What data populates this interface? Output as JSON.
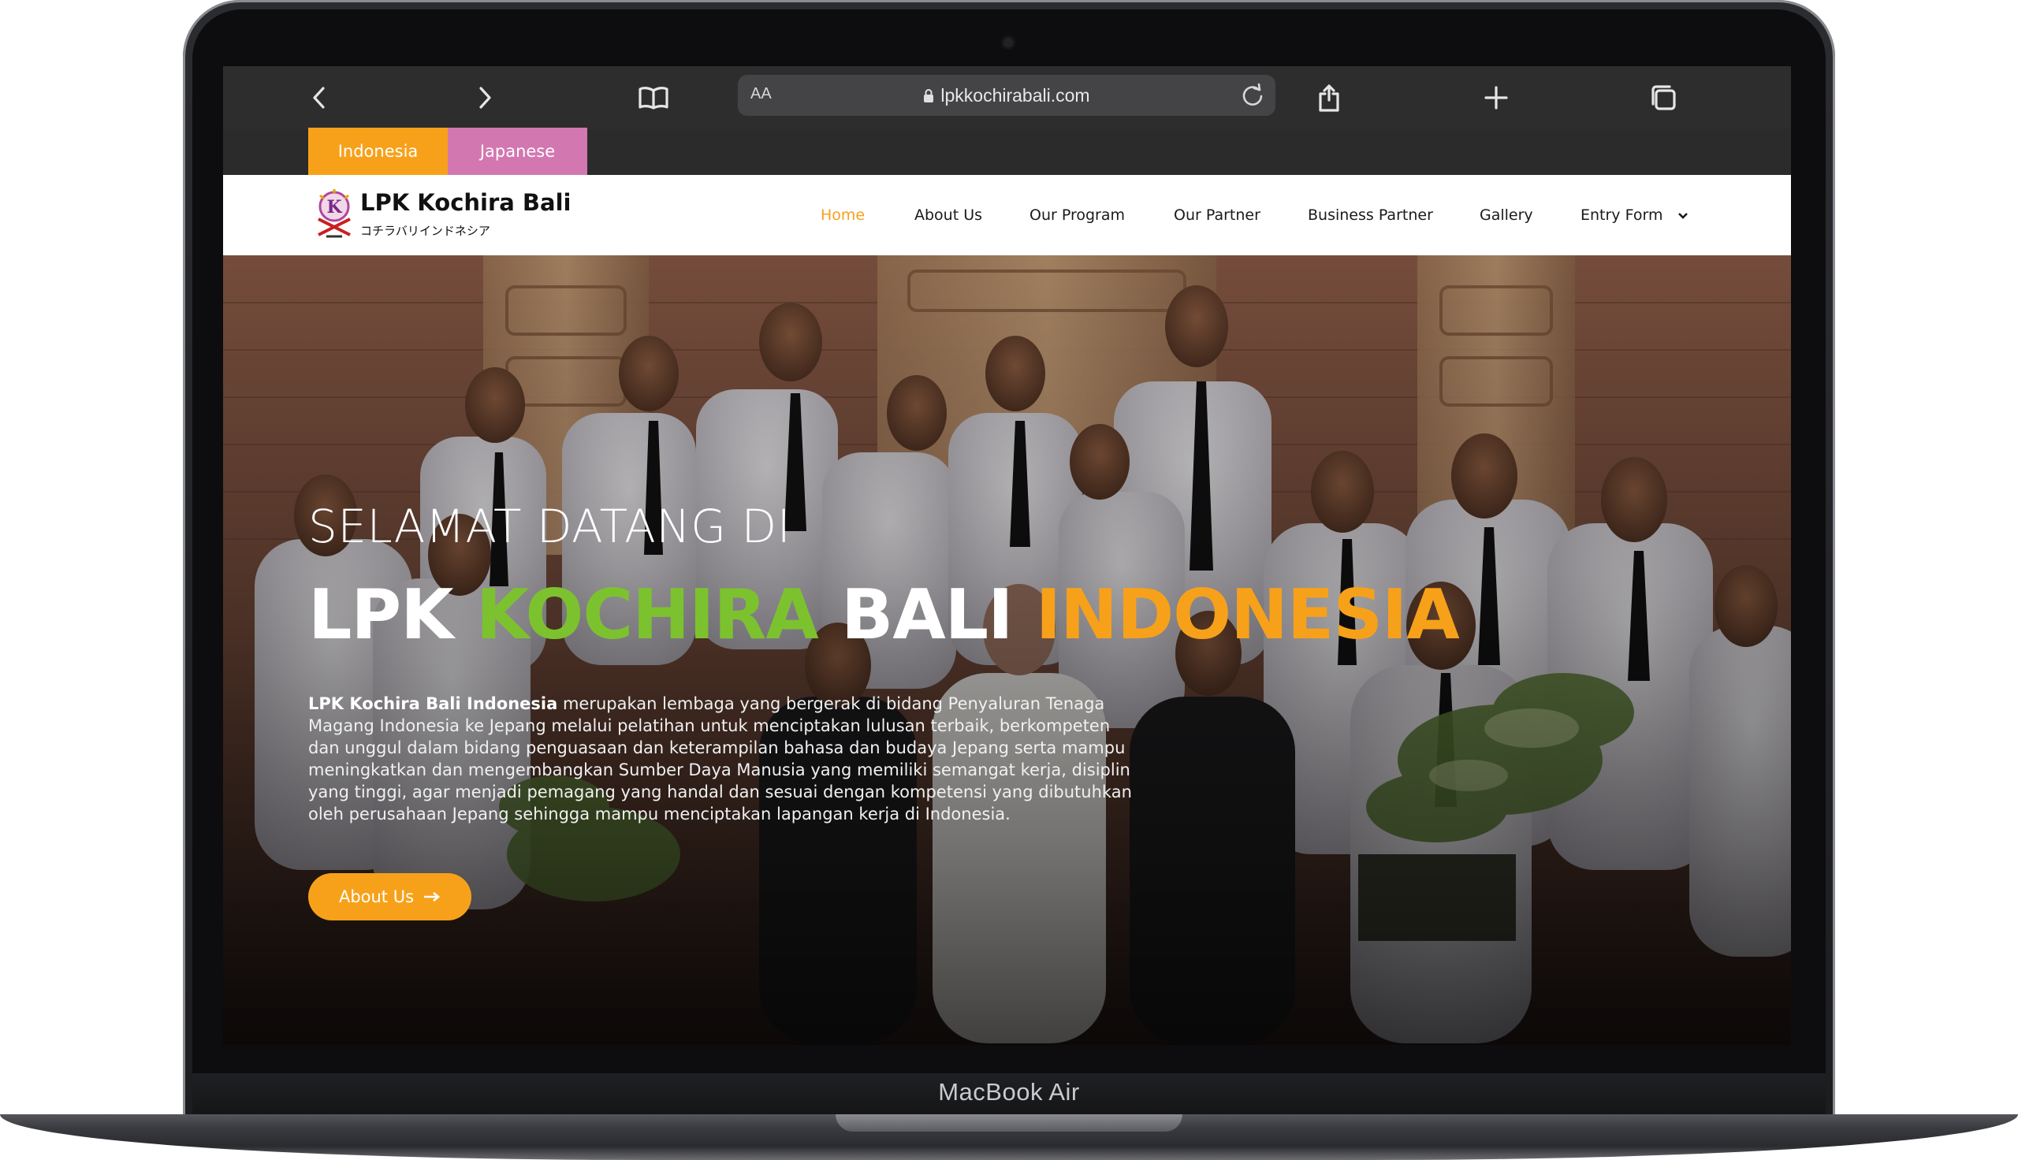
{
  "device": {
    "label": "MacBook Air"
  },
  "browser": {
    "aa_label": "AA",
    "url": "lpkkochirabali.com",
    "icons": [
      "chevron-left-icon",
      "chevron-right-icon",
      "bookmarks-icon",
      "lock-icon",
      "reload-icon",
      "share-icon",
      "plus-icon",
      "tabs-icon"
    ]
  },
  "languages": {
    "indonesia": "Indonesia",
    "japanese": "Japanese"
  },
  "site": {
    "logo_title": "LPK Kochira Bali",
    "logo_subtitle": "コチラバリインドネシア",
    "nav": {
      "home": "Home",
      "about": "About Us",
      "program": "Our Program",
      "partner": "Our Partner",
      "business": "Business Partner",
      "gallery": "Gallery",
      "entry": "Entry Form"
    }
  },
  "hero": {
    "welcome": "SELAMAT DATANG DI",
    "title_part1": "LPK ",
    "title_part2": "KOCHIRA",
    "title_part3": " BALI ",
    "title_part4": "INDONESIA",
    "desc_bold": "LPK Kochira Bali Indonesia",
    "desc_rest": " merupakan lembaga yang bergerak di bidang Penyaluran Tenaga Magang Indonesia ke Jepang melalui pelatihan untuk menciptakan lulusan terbaik, berkompeten dan unggul dalam bidang penguasaan dan keterampilan bahasa dan budaya Jepang serta mampu meningkatkan dan mengembangkan Sumber Daya Manusia yang memiliki semangat kerja, disiplin yang tinggi, agar menjadi pemagang yang handal dan sesuai dengan kompetensi yang dibutuhkan oleh perusahaan Jepang sehingga mampu menciptakan lapangan kerja di Indonesia.",
    "cta_label": "About Us"
  },
  "colors": {
    "orange": "#f7a11a",
    "green": "#7cc22e",
    "pink": "#d377b0"
  }
}
